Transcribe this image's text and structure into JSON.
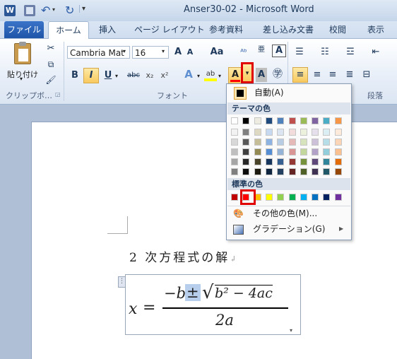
{
  "window": {
    "title": "Anser30-02 - Microsoft Word"
  },
  "tabs": [
    {
      "label": "ファイル"
    },
    {
      "label": "ホーム"
    },
    {
      "label": "挿入"
    },
    {
      "label": "ページ レイアウト"
    },
    {
      "label": "参考資料"
    },
    {
      "label": "差し込み文書"
    },
    {
      "label": "校閲"
    },
    {
      "label": "表示"
    }
  ],
  "ribbon": {
    "clipboard": {
      "paste_label": "貼り付け",
      "group_label": "クリップボ…"
    },
    "font": {
      "font_name": "Cambria Mat",
      "font_size": "16",
      "group_label": "フォント",
      "bold": "B",
      "italic": "I",
      "underline": "U",
      "strike": "abc",
      "subscript": "x₂",
      "superscript": "x²",
      "grow": "A",
      "shrink": "A",
      "case": "Aa",
      "font_color_letter": "A"
    },
    "paragraph": {
      "group_label": "段落"
    }
  },
  "color_menu": {
    "auto_label": "自動(A)",
    "theme_header": "テーマの色",
    "standard_header": "標準の色",
    "more_colors_label": "その他の色(M)...",
    "gradient_label": "グラデーション(G)",
    "theme_top_row": [
      "#ffffff",
      "#000000",
      "#eeece1",
      "#1f497d",
      "#4f81bd",
      "#c0504d",
      "#9bbb59",
      "#8064a2",
      "#4bacc6",
      "#f79646"
    ],
    "theme_shades": [
      [
        "#f2f2f2",
        "#7f7f7f",
        "#ddd9c3",
        "#c6d9f0",
        "#dbe5f1",
        "#f2dcdb",
        "#ebf1dd",
        "#e5e0ec",
        "#dbeef3",
        "#fdeada"
      ],
      [
        "#d8d8d8",
        "#595959",
        "#c4bd97",
        "#8db3e2",
        "#b8cce4",
        "#e5b9b7",
        "#d7e3bc",
        "#ccc1d9",
        "#b7dde8",
        "#fbd5b5"
      ],
      [
        "#bfbfbf",
        "#3f3f3f",
        "#938953",
        "#548dd4",
        "#95b3d7",
        "#d99694",
        "#c3d69b",
        "#b2a2c7",
        "#92cddc",
        "#fac08f"
      ],
      [
        "#a5a5a5",
        "#262626",
        "#494429",
        "#17365d",
        "#366092",
        "#953734",
        "#76923c",
        "#5f497a",
        "#31859b",
        "#e36c09"
      ],
      [
        "#7f7f7f",
        "#0c0c0c",
        "#1d1b10",
        "#0f243e",
        "#244061",
        "#632423",
        "#4f6128",
        "#3f3151",
        "#205867",
        "#974806"
      ]
    ],
    "standard_colors": [
      "#c00000",
      "#ff0000",
      "#ffc000",
      "#ffff00",
      "#92d050",
      "#00b050",
      "#00b0f0",
      "#0070c0",
      "#002060",
      "#7030a0"
    ],
    "selected_standard_index": 1
  },
  "document": {
    "heading": "2 次方程式の解",
    "equation": {
      "x": "x",
      "equals": "=",
      "minus_b": "−b",
      "pm": "±",
      "radicand": "b² − 4ac",
      "denominator": "2a"
    }
  }
}
